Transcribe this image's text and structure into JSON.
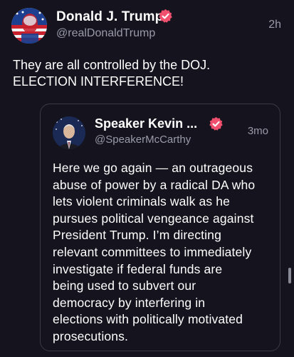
{
  "post": {
    "author_name": "Donald J. Trump",
    "author_handle": "@realDonaldTrump",
    "timestamp": "2h",
    "text": "They are all controlled by the DOJ.\nELECTION INTERFERENCE!",
    "verified_icon": "verified-badge-icon",
    "avatar_icon": "flag-portrait-avatar"
  },
  "quoted_post": {
    "author_name": "Speaker Kevin ...",
    "author_handle": "@SpeakerMcCarthy",
    "timestamp": "3mo",
    "text": "Here we go again — an outrageous\nabuse of power by a radical DA who\nlets violent criminals walk as he\npursues political vengeance against\nPresident Trump. I’m directing\nrelevant committees to immediately\ninvestigate if federal funds are\nbeing used to subvert our\ndemocracy by interfering in\nelections with politically motivated\nprosecutions.",
    "verified_icon": "verified-badge-icon",
    "avatar_icon": "portrait-avatar"
  },
  "colors": {
    "background": "#15141e",
    "verified_badge": "#f0506e",
    "secondary_text": "#9a99a8",
    "quote_border": "#3a3946"
  }
}
